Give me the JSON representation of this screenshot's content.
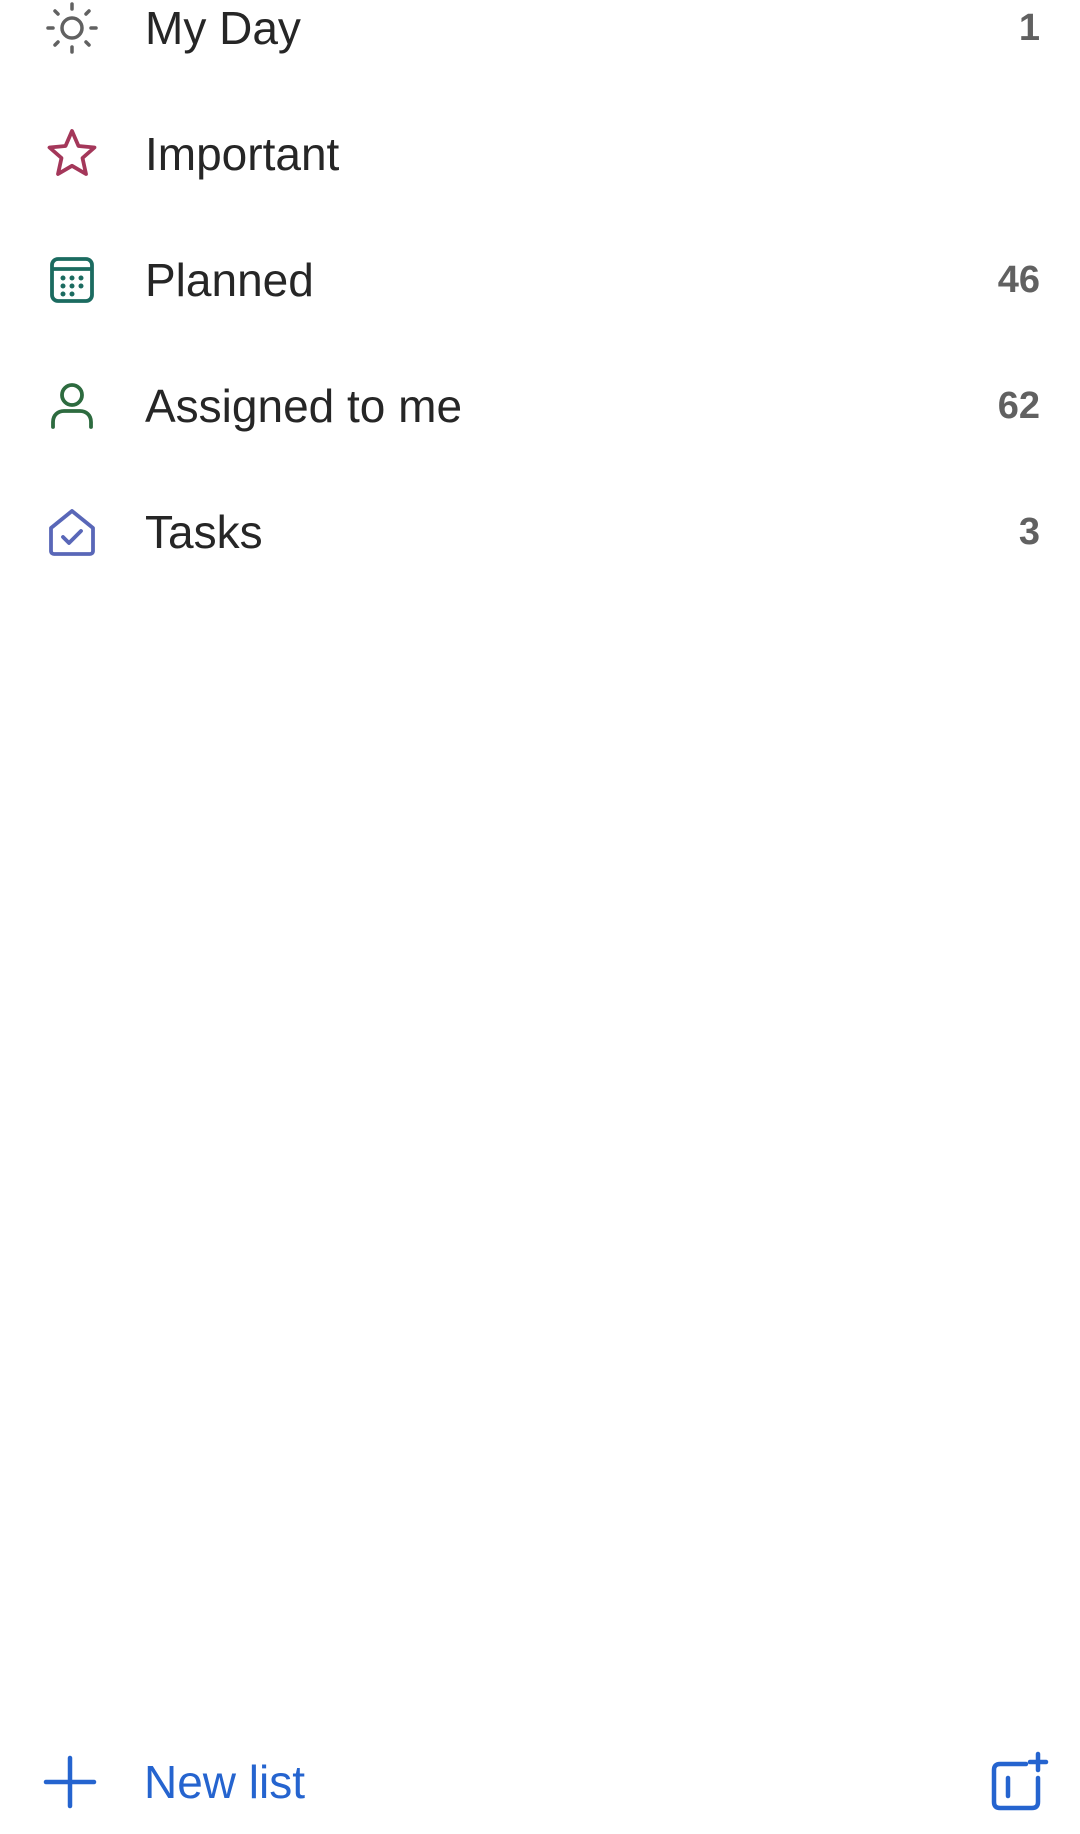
{
  "smart_lists": [
    {
      "label": "My Day",
      "count": "1",
      "icon": "sun-icon",
      "color": "#616161"
    },
    {
      "label": "Important",
      "count": "",
      "icon": "star-icon",
      "color": "#a4375a"
    },
    {
      "label": "Planned",
      "count": "46",
      "icon": "calendar-icon",
      "color": "#1b6b60"
    },
    {
      "label": "Assigned to me",
      "count": "62",
      "icon": "person-icon",
      "color": "#2d6b3f"
    },
    {
      "label": "Tasks",
      "count": "3",
      "icon": "home-check-icon",
      "color": "#5967b8"
    }
  ],
  "footer": {
    "new_list_label": "New list",
    "accent_color": "#2564cf",
    "plus_icon": "plus-icon",
    "new_group_icon": "new-group-icon"
  }
}
